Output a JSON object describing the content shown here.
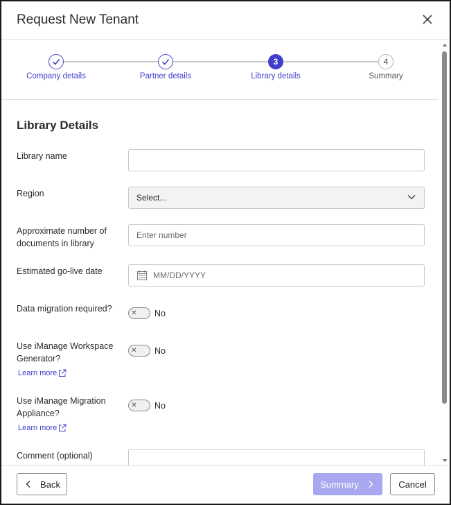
{
  "dialog": {
    "title": "Request New Tenant"
  },
  "stepper": {
    "steps": [
      {
        "label": "Company details",
        "state": "done",
        "number": "1"
      },
      {
        "label": "Partner details",
        "state": "done",
        "number": "2"
      },
      {
        "label": "Library details",
        "state": "current",
        "number": "3"
      },
      {
        "label": "Summary",
        "state": "todo",
        "number": "4"
      }
    ]
  },
  "form": {
    "section_title": "Library Details",
    "library_name": {
      "label": "Library name",
      "value": ""
    },
    "region": {
      "label": "Region",
      "value": "Select..."
    },
    "documents": {
      "label": "Approximate number of documents in library",
      "placeholder": "Enter number"
    },
    "golive": {
      "label": "Estimated go-live date",
      "placeholder": "MM/DD/YYYY"
    },
    "migration": {
      "label": "Data migration required?",
      "toggle_text": "No"
    },
    "workspace_gen": {
      "label": "Use iManage Workspace Generator?",
      "toggle_text": "No",
      "link": "Learn more"
    },
    "migration_appliance": {
      "label": "Use iManage Migration Appliance?",
      "toggle_text": "No",
      "link": "Learn more"
    },
    "comment": {
      "label": "Comment (optional)"
    }
  },
  "footer": {
    "back_label": "Back",
    "summary_label": "Summary",
    "cancel_label": "Cancel"
  },
  "colors": {
    "accent": "#3f3fc9",
    "primary_disabled": "#a8a8f0"
  }
}
